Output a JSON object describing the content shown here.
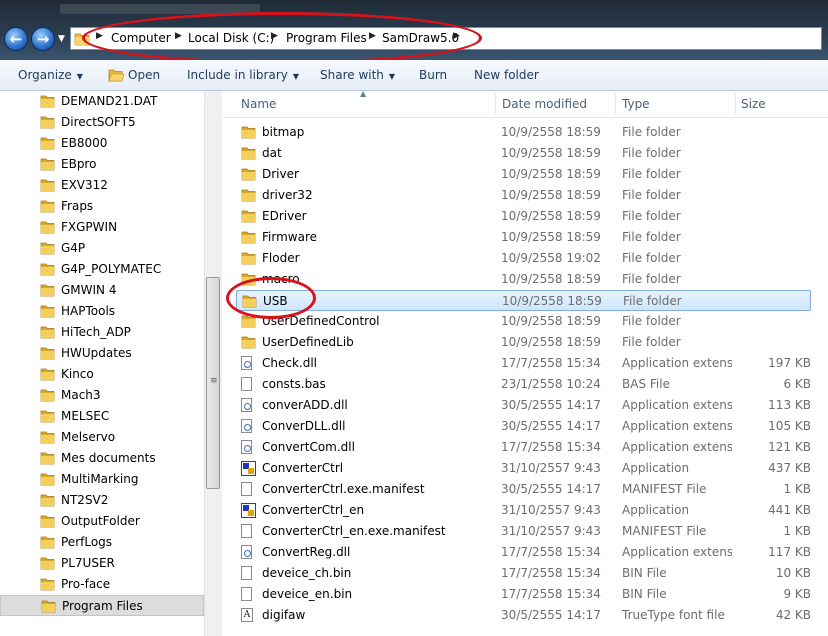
{
  "address": {
    "crumbs": [
      "Computer",
      "Local Disk (C:)",
      "Program Files",
      "SamDraw5.0"
    ]
  },
  "toolbar": {
    "organize": "Organize",
    "open": "Open",
    "include_in_library": "Include in library",
    "share_with": "Share with",
    "burn": "Burn",
    "new_folder": "New folder"
  },
  "nav": {
    "items": [
      "DEMAND21.DAT",
      "DirectSOFT5",
      "EB8000",
      "EBpro",
      "EXV312",
      "Fraps",
      "FXGPWIN",
      "G4P",
      "G4P_POLYMATEC",
      "GMWIN 4",
      "HAPTools",
      "HiTech_ADP",
      "HWUpdates",
      "Kinco",
      "Mach3",
      "MELSEC",
      "Melservo",
      "Mes documents",
      "MultiMarking",
      "NT2SV2",
      "OutputFolder",
      "PerfLogs",
      "PL7USER",
      "Pro-face",
      "Program Files"
    ],
    "selected": "Program Files"
  },
  "columns": {
    "name": "Name",
    "date": "Date modified",
    "type": "Type",
    "size": "Size"
  },
  "files": [
    {
      "name": "bitmap",
      "date": "10/9/2558 18:59",
      "type": "File folder",
      "size": "",
      "icon": "folder"
    },
    {
      "name": "dat",
      "date": "10/9/2558 18:59",
      "type": "File folder",
      "size": "",
      "icon": "folder"
    },
    {
      "name": "Driver",
      "date": "10/9/2558 18:59",
      "type": "File folder",
      "size": "",
      "icon": "folder"
    },
    {
      "name": "driver32",
      "date": "10/9/2558 18:59",
      "type": "File folder",
      "size": "",
      "icon": "folder"
    },
    {
      "name": "EDriver",
      "date": "10/9/2558 18:59",
      "type": "File folder",
      "size": "",
      "icon": "folder"
    },
    {
      "name": "Firmware",
      "date": "10/9/2558 18:59",
      "type": "File folder",
      "size": "",
      "icon": "folder"
    },
    {
      "name": "Floder",
      "date": "10/9/2558 19:02",
      "type": "File folder",
      "size": "",
      "icon": "folder"
    },
    {
      "name": "macro",
      "date": "10/9/2558 18:59",
      "type": "File folder",
      "size": "",
      "icon": "folder"
    },
    {
      "name": "USB",
      "date": "10/9/2558 18:59",
      "type": "File folder",
      "size": "",
      "icon": "folder"
    },
    {
      "name": "UserDefinedControl",
      "date": "10/9/2558 18:59",
      "type": "File folder",
      "size": "",
      "icon": "folder"
    },
    {
      "name": "UserDefinedLib",
      "date": "10/9/2558 18:59",
      "type": "File folder",
      "size": "",
      "icon": "folder"
    },
    {
      "name": "Check.dll",
      "date": "17/7/2558 15:34",
      "type": "Application extens...",
      "size": "197 KB",
      "icon": "dll"
    },
    {
      "name": "consts.bas",
      "date": "23/1/2558 10:24",
      "type": "BAS File",
      "size": "6 KB",
      "icon": "doc"
    },
    {
      "name": "converADD.dll",
      "date": "30/5/2555 14:17",
      "type": "Application extens...",
      "size": "113 KB",
      "icon": "dll"
    },
    {
      "name": "ConverDLL.dll",
      "date": "30/5/2555 14:17",
      "type": "Application extens...",
      "size": "105 KB",
      "icon": "dll"
    },
    {
      "name": "ConvertCom.dll",
      "date": "17/7/2558 15:34",
      "type": "Application extens...",
      "size": "121 KB",
      "icon": "dll"
    },
    {
      "name": "ConverterCtrl",
      "date": "31/10/2557 9:43",
      "type": "Application",
      "size": "437 KB",
      "icon": "app"
    },
    {
      "name": "ConverterCtrl.exe.manifest",
      "date": "30/5/2555 14:17",
      "type": "MANIFEST File",
      "size": "1 KB",
      "icon": "doc"
    },
    {
      "name": "ConverterCtrl_en",
      "date": "31/10/2557 9:43",
      "type": "Application",
      "size": "441 KB",
      "icon": "app"
    },
    {
      "name": "ConverterCtrl_en.exe.manifest",
      "date": "31/10/2557 9:43",
      "type": "MANIFEST File",
      "size": "1 KB",
      "icon": "doc"
    },
    {
      "name": "ConvertReg.dll",
      "date": "17/7/2558 15:34",
      "type": "Application extens...",
      "size": "117 KB",
      "icon": "dll"
    },
    {
      "name": "deveice_ch.bin",
      "date": "17/7/2558 15:34",
      "type": "BIN File",
      "size": "10 KB",
      "icon": "doc"
    },
    {
      "name": "deveice_en.bin",
      "date": "17/7/2558 15:34",
      "type": "BIN File",
      "size": "9 KB",
      "icon": "doc"
    },
    {
      "name": "digifaw",
      "date": "30/5/2555 14:17",
      "type": "TrueType font file",
      "size": "42 KB",
      "icon": "font"
    }
  ],
  "selected_file": "USB"
}
